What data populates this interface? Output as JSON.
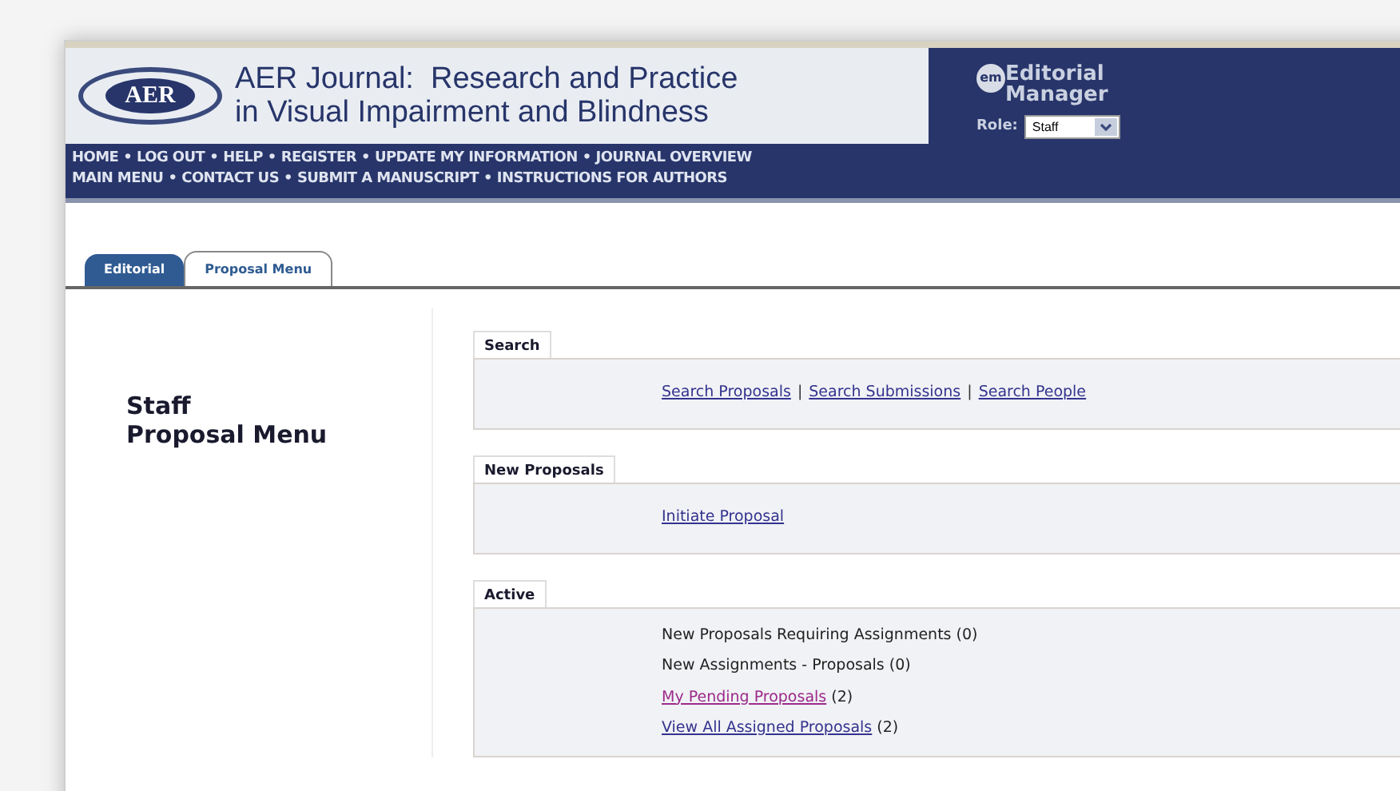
{
  "header": {
    "logo": "AER",
    "title_lines": [
      "AER Journal:  Research and Practice",
      "in Visual Impairment and Blindness"
    ],
    "brand_badge": "em",
    "brand_lines": [
      "Editorial",
      "Manager"
    ],
    "role_label": "Role:",
    "role_value": "Staff"
  },
  "nav": {
    "separator": "•",
    "lines": [
      {
        "links": [
          "HOME",
          "LOG OUT",
          "HELP",
          "REGISTER",
          "UPDATE MY INFORMATION",
          "JOURNAL OVERVIEW"
        ]
      },
      {
        "links": [
          "MAIN MENU",
          "CONTACT US",
          "SUBMIT A MANUSCRIPT",
          "INSTRUCTIONS FOR AUTHORS"
        ]
      }
    ]
  },
  "tabs": [
    {
      "label": "Editorial",
      "selected": false
    },
    {
      "label": "Proposal Menu",
      "selected": true
    }
  ],
  "page_title": [
    "Staff",
    "Proposal Menu"
  ],
  "sections": [
    {
      "title": "Search",
      "kind": "inline",
      "divider": "|",
      "items": [
        {
          "kind": "link",
          "label": "Search Proposals"
        },
        {
          "kind": "link",
          "label": "Search Submissions"
        },
        {
          "kind": "link",
          "label": "Search People"
        }
      ]
    },
    {
      "title": "New Proposals",
      "kind": "list",
      "items": [
        {
          "kind": "link",
          "label": "Initiate Proposal"
        }
      ]
    },
    {
      "title": "Active",
      "kind": "list",
      "items": [
        {
          "kind": "plain",
          "label": "New Proposals Requiring Assignments (0)"
        },
        {
          "kind": "plain",
          "label": "New Assignments - Proposals (0)"
        },
        {
          "kind": "visited",
          "label": "My Pending Proposals",
          "count": "(2)"
        },
        {
          "kind": "link",
          "label": "View All Assigned Proposals",
          "count": "(2)"
        }
      ]
    }
  ]
}
